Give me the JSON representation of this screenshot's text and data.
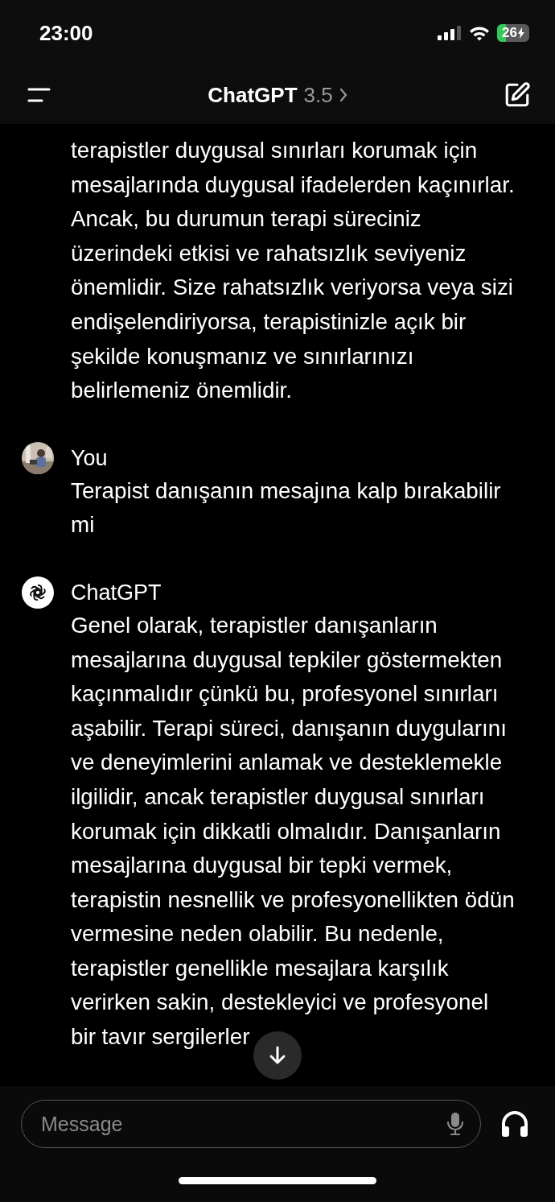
{
  "status_bar": {
    "time": "23:00",
    "battery": "26"
  },
  "header": {
    "title": "ChatGPT",
    "model": "3.5"
  },
  "messages": [
    {
      "kind": "assistant",
      "text": "terapistler duygusal sınırları korumak için mesajlarında duygusal ifadelerden kaçınırlar. Ancak, bu durumun terapi süreciniz üzerindeki etkisi ve rahatsızlık seviyeniz önemlidir. Size rahatsızlık veriyorsa veya sizi endişelendiriyorsa, terapistinizle açık bir şekilde konuşmanız ve sınırlarınızı belirlemeniz önemlidir."
    },
    {
      "kind": "user",
      "sender": "You",
      "text": "Terapist danışanın mesajına kalp bırakabilir mi"
    },
    {
      "kind": "assistant",
      "sender": "ChatGPT",
      "text": "Genel olarak, terapistler danışanların mesajlarına duygusal tepkiler göstermekten kaçınmalıdır çünkü bu, profesyonel sınırları aşabilir. Terapi süreci, danışanın duygularını ve deneyimlerini anlamak ve desteklemekle ilgilidir, ancak terapistler duygusal sınırları korumak için dikkatli olmalıdır. Danışanların mesajlarına duygusal bir tepki vermek, terapistin nesnellik ve profesyonellikten ödün vermesine neden olabilir. Bu nedenle, terapistler genellikle mesajlara karşılık verirken sakin, destekleyici ve profesyonel bir tavır sergilerler"
    }
  ],
  "composer": {
    "placeholder": "Message"
  }
}
